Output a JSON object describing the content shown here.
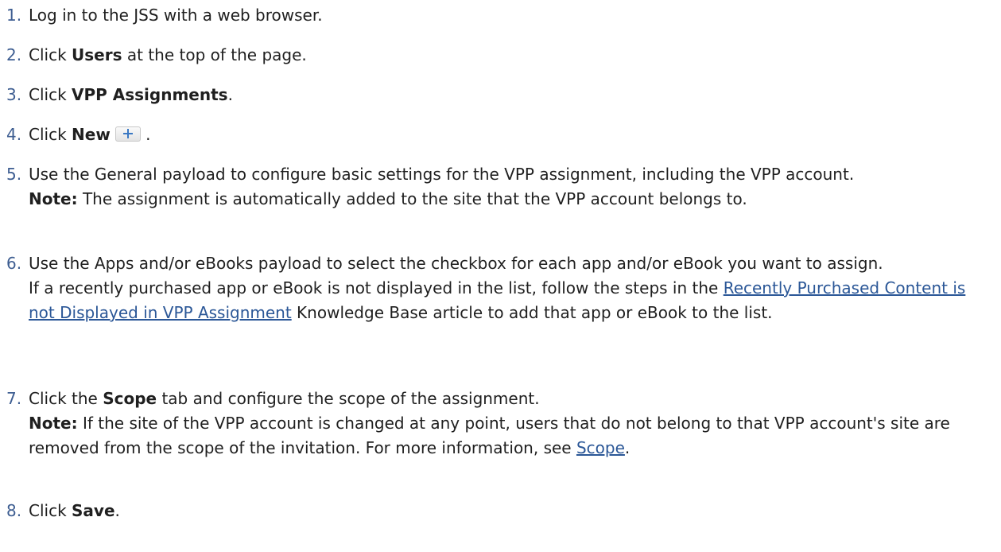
{
  "steps": [
    {
      "num": "1.",
      "pre": "Log in to the JSS with a web browser."
    },
    {
      "num": "2.",
      "pre": "Click ",
      "bold": "Users",
      "post": " at the top of the page."
    },
    {
      "num": "3.",
      "pre": "Click ",
      "bold": "VPP Assignments",
      "post": "."
    },
    {
      "num": "4.",
      "pre": "Click ",
      "bold": "New",
      "post": " ."
    },
    {
      "num": "5.",
      "text": "Use the General payload to configure basic settings for the VPP assignment, including the VPP account.",
      "note_label": "Note:",
      "note_text": " The assignment is automatically added to the site that the VPP account belongs to."
    },
    {
      "num": "6.",
      "text": "Use the Apps and/or eBooks payload to select the checkbox for each app and/or eBook you want to assign.",
      "text2_pre": "If a recently purchased app or eBook is not displayed in the list, follow the steps in the ",
      "link": "Recently Purchased Content is not Displayed in VPP Assignment",
      "text2_post": " Knowledge Base article to add that app or eBook to the list."
    },
    {
      "num": "7.",
      "pre": "Click the ",
      "bold": "Scope",
      "post": " tab and configure the scope of the assignment.",
      "note_label": "Note:",
      "note_text": " If the site of the VPP account is changed at any point, users that do not belong to that VPP account's site are removed from the scope of the invitation. For more information, see ",
      "note_link": "Scope",
      "note_end": "."
    },
    {
      "num": "8.",
      "pre": "Click ",
      "bold": "Save",
      "post": "."
    }
  ]
}
